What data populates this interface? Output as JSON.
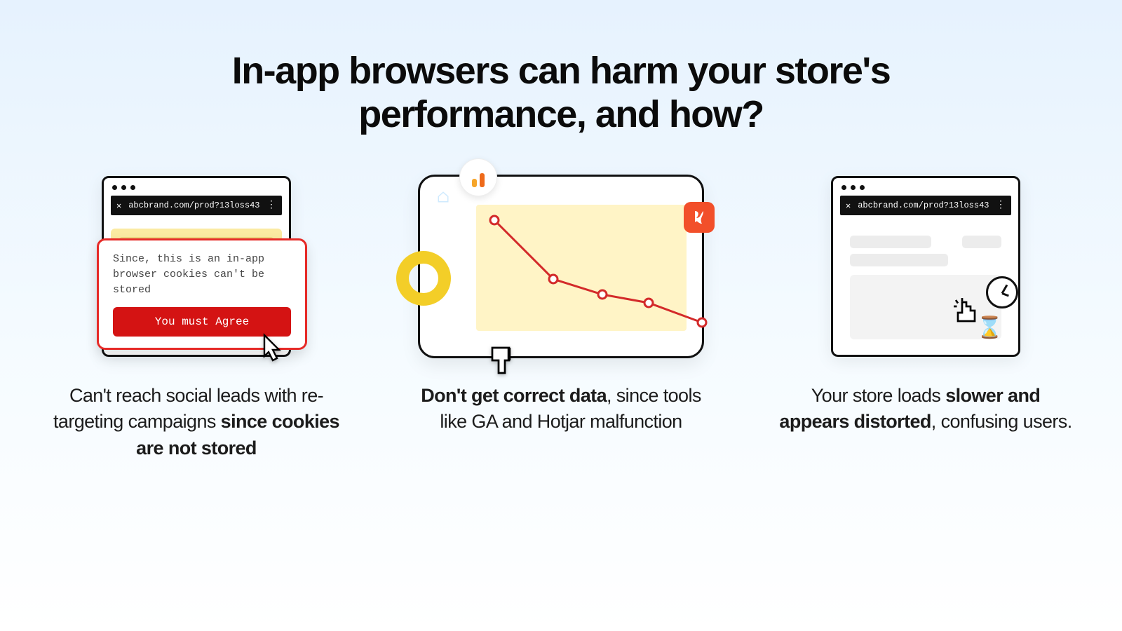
{
  "title": "In-app browsers can harm your store's performance, and how?",
  "columns": {
    "c1": {
      "url": "abcbrand.com/prod?13loss43",
      "tooltip_msg": "Since, this is an in-app browser cookies can't be stored",
      "tooltip_btn": "You must Agree",
      "caption_pre": "Can't reach social leads with re-targeting campaigns ",
      "caption_bold": "since cookies are not stored"
    },
    "c2": {
      "caption_bold": "Don't get correct data",
      "caption_post": ", since tools like GA and Hotjar malfunction"
    },
    "c3": {
      "url": "abcbrand.com/prod?13loss43",
      "caption_pre": "Your store loads ",
      "caption_bold": "slower and appears distorted",
      "caption_post": ", confusing users."
    }
  },
  "chart_data": {
    "type": "line",
    "title": "",
    "xlabel": "",
    "ylabel": "",
    "x": [
      0,
      1,
      2,
      3,
      4
    ],
    "values": [
      92,
      60,
      50,
      44,
      34
    ],
    "ylim": [
      0,
      100
    ]
  }
}
